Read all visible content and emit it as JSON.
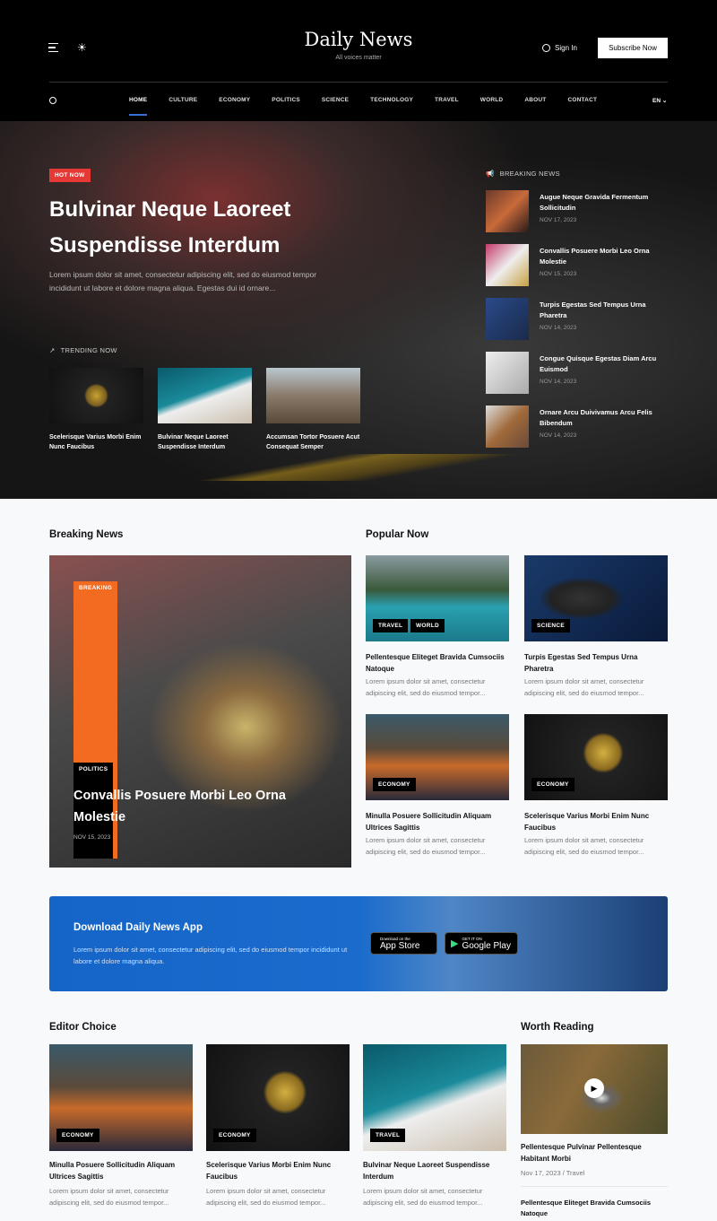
{
  "header": {
    "logo": "Daily News",
    "tagline": "All voices matter",
    "sign_in": "Sign In",
    "subscribe": "Subscribe Now",
    "language": "EN",
    "nav": [
      "HOME",
      "CULTURE",
      "ECONOMY",
      "POLITICS",
      "SCIENCE",
      "TECHNOLOGY",
      "TRAVEL",
      "WORLD",
      "ABOUT",
      "CONTACT"
    ],
    "active_nav": "HOME"
  },
  "hero": {
    "badge": "HOT NOW",
    "title": "Bulvinar Neque Laoreet Suspendisse Interdum",
    "excerpt": "Lorem ipsum dolor sit amet, consectetur adipiscing elit, sed do eiusmod tempor incididunt ut labore et dolore magna aliqua. Egestas dui id ornare...",
    "trending_label": "TRENDING NOW",
    "trending": [
      {
        "title": "Scelerisque Varius Morbi Enim Nunc Faucibus"
      },
      {
        "title": "Bulvinar Neque Laoreet Suspendisse Interdum"
      },
      {
        "title": "Accumsan Tortor Posuere Acut Consequat Semper"
      }
    ],
    "breaking_label": "BREAKING NEWS",
    "breaking": [
      {
        "title": "Augue Neque Gravida Fermentum Sollicitudin",
        "date": "NOV 17, 2023"
      },
      {
        "title": "Convallis Posuere Morbi Leo Orna Molestie",
        "date": "NOV 15, 2023"
      },
      {
        "title": "Turpis Egestas Sed Tempus Urna Pharetra",
        "date": "NOV 14, 2023"
      },
      {
        "title": "Congue Quisque Egestas Diam Arcu Euismod",
        "date": "NOV 14, 2023"
      },
      {
        "title": "Ornare Arcu Duivivamus Arcu Felis Bibendum",
        "date": "NOV 14, 2023"
      }
    ]
  },
  "breaking_section": {
    "heading": "Breaking News",
    "badge": "BREAKING",
    "category": "POLITICS",
    "title": "Convallis Posuere Morbi Leo Orna Molestie",
    "date": "NOV 15, 2023"
  },
  "popular": {
    "heading": "Popular Now",
    "items": [
      {
        "tags": [
          "TRAVEL",
          "WORLD"
        ],
        "title": "Pellentesque Eliteget Bravida Cumsociis Natoque",
        "excerpt": "Lorem ipsum dolor sit amet, consectetur adipiscing elit, sed do eiusmod tempor..."
      },
      {
        "tags": [
          "SCIENCE"
        ],
        "title": "Turpis Egestas Sed Tempus Urna Pharetra",
        "excerpt": "Lorem ipsum dolor sit amet, consectetur adipiscing elit, sed do eiusmod tempor..."
      },
      {
        "tags": [
          "ECONOMY"
        ],
        "title": "Minulla Posuere Sollicitudin Aliquam Ultrices Sagittis",
        "excerpt": "Lorem ipsum dolor sit amet, consectetur adipiscing elit, sed do eiusmod tempor..."
      },
      {
        "tags": [
          "ECONOMY"
        ],
        "title": "Scelerisque Varius Morbi Enim Nunc Faucibus",
        "excerpt": "Lorem ipsum dolor sit amet, consectetur adipiscing elit, sed do eiusmod tempor..."
      }
    ]
  },
  "app_banner": {
    "title": "Download Daily News App",
    "text": "Lorem ipsum dolor sit amet, consectetur adipiscing elit, sed do eiusmod tempor incididunt ut labore et dolore magna aliqua.",
    "app_store_small": "Download on the",
    "app_store": "App Store",
    "google_small": "GET IT ON",
    "google": "Google Play"
  },
  "editor": {
    "heading": "Editor Choice",
    "items": [
      {
        "tag": "ECONOMY",
        "title": "Minulla Posuere Sollicitudin Aliquam Ultrices Sagittis",
        "excerpt": "Lorem ipsum dolor sit amet, consectetur adipiscing elit, sed do eiusmod tempor..."
      },
      {
        "tag": "ECONOMY",
        "title": "Scelerisque Varius Morbi Enim Nunc Faucibus",
        "excerpt": "Lorem ipsum dolor sit amet, consectetur adipiscing elit, sed do eiusmod tempor..."
      },
      {
        "tag": "TRAVEL",
        "title": "Bulvinar Neque Laoreet Suspendisse Interdum",
        "excerpt": "Lorem ipsum dolor sit amet, consectetur adipiscing elit, sed do eiusmod tempor..."
      }
    ]
  },
  "worth": {
    "heading": "Worth Reading",
    "items": [
      {
        "title": "Pellentesque Pulvinar Pellentesque Habitant Morbi",
        "meta": "Nov 17, 2023 / Travel"
      },
      {
        "title": "Pellentesque Eliteget Bravida Cumsociis Natoque"
      }
    ]
  },
  "colors": {
    "accent": "#3b6fd9",
    "hot": "#e53935",
    "breaking": "#f26b21",
    "banner": "#1565c9"
  }
}
